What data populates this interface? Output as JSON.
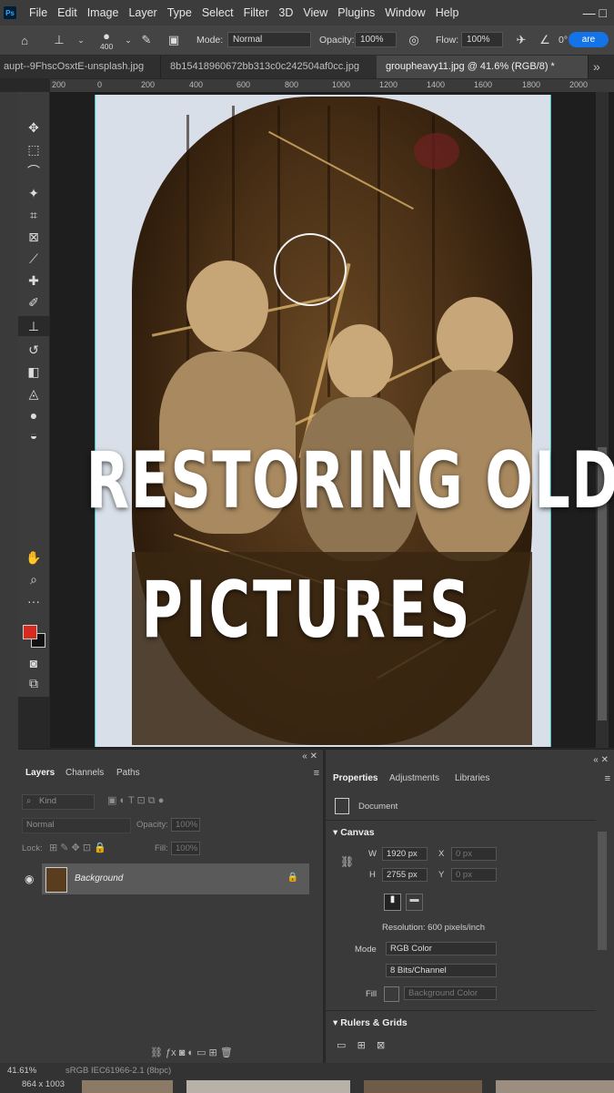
{
  "menubar": {
    "logo": "Ps",
    "items": [
      "File",
      "Edit",
      "Image",
      "Layer",
      "Type",
      "Select",
      "Filter",
      "3D",
      "View",
      "Plugins",
      "Window",
      "Help"
    ],
    "controls": "—  □"
  },
  "options": {
    "brush_size": "400",
    "mode_label": "Mode:",
    "mode_value": "Normal",
    "opacity_label": "Opacity:",
    "opacity_value": "100%",
    "flow_label": "Flow:",
    "flow_value": "100%",
    "angle_value": "0°",
    "share_label": "are"
  },
  "tabs": [
    {
      "label": "aupt--9FhscOsxtE-unsplash.jpg"
    },
    {
      "label": "8b15418960672bb313c0c242504af0cc.jpg"
    },
    {
      "label": "groupheavy11.jpg @ 41.6% (RGB/8) *"
    }
  ],
  "tabs_extra": "»",
  "ruler": [
    "200",
    "0",
    "200",
    "400",
    "600",
    "800",
    "1000",
    "1200",
    "1400",
    "1600",
    "1800",
    "2000"
  ],
  "overlay": {
    "line1": "RESTORING OLD",
    "line2": "PICTURES"
  },
  "layers_panel": {
    "tabs": [
      "Layers",
      "Channels",
      "Paths"
    ],
    "filter_placeholder": "Kind",
    "blend_mode": "Normal",
    "opacity_label": "Opacity:",
    "opacity_value": "100%",
    "lock_label": "Lock:",
    "fill_label": "Fill:",
    "fill_value": "100%",
    "layer_name": "Background"
  },
  "properties_panel": {
    "tabs": [
      "Properties",
      "Adjustments",
      "Libraries"
    ],
    "document_label": "Document",
    "canvas_title": "Canvas",
    "w_label": "W",
    "w_value": "1920 px",
    "h_label": "H",
    "h_value": "2755 px",
    "x_label": "X",
    "x_value": "0 px",
    "y_label": "Y",
    "y_value": "0 px",
    "resolution": "Resolution: 600 pixels/inch",
    "mode_label": "Mode",
    "mode_value": "RGB Color",
    "bits_value": "8 Bits/Channel",
    "fill_label": "Fill",
    "fill_value": "Background Color",
    "rulers_title": "Rulers & Grids"
  },
  "status": {
    "zoom": "41.61%",
    "profile": "sRGB IEC61966-2.1 (8bpc)",
    "dims": "864 x 1003"
  },
  "colors": {
    "foreground": "#d62b1f",
    "background": "#111111",
    "accent": "#1473e6"
  }
}
